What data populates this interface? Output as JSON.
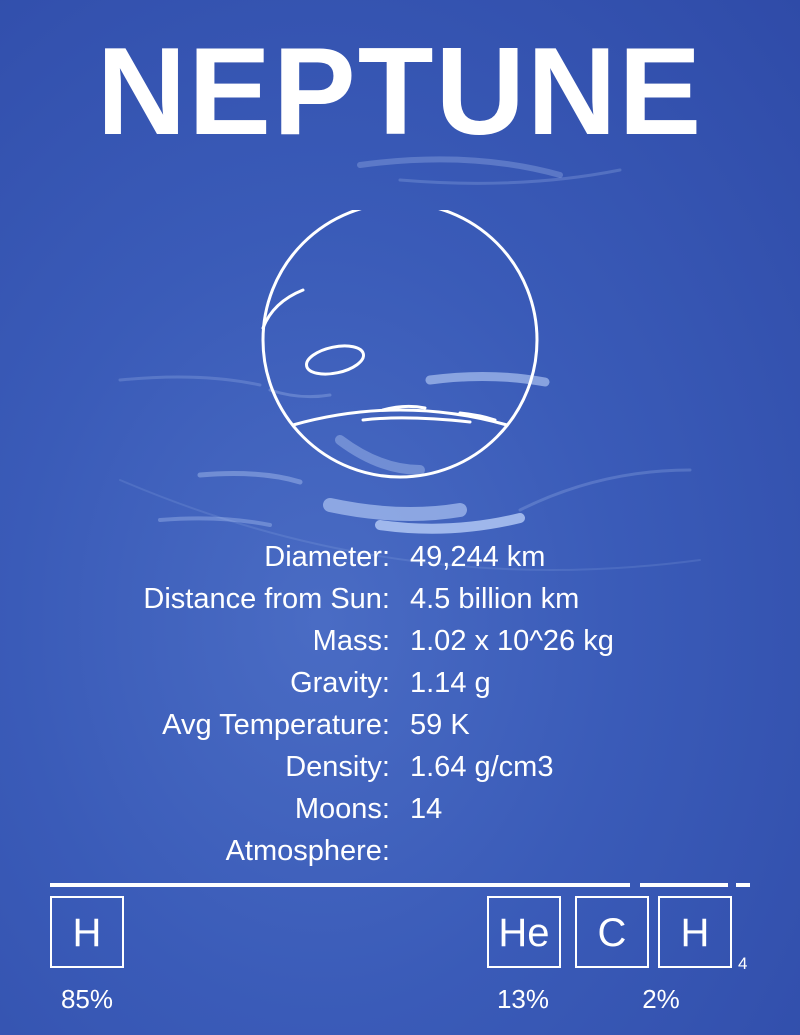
{
  "title": "NEPTUNE",
  "facts": [
    {
      "label": "Diameter:",
      "value": "49,244 km"
    },
    {
      "label": "Distance from Sun:",
      "value": "4.5 billion km"
    },
    {
      "label": "Mass:",
      "value": "1.02 x 10^26 kg"
    },
    {
      "label": "Gravity:",
      "value": "1.14 g"
    },
    {
      "label": "Avg Temperature:",
      "value": "59 K"
    },
    {
      "label": "Density:",
      "value": "1.64 g/cm3"
    },
    {
      "label": "Moons:",
      "value": "14"
    },
    {
      "label": "Atmosphere:",
      "value": ""
    }
  ],
  "atmosphere": {
    "elements": [
      {
        "symbol": "H"
      },
      {
        "symbol": "He"
      },
      {
        "symbol": "C"
      },
      {
        "symbol": "H",
        "subscript": "4"
      }
    ],
    "percentages": [
      "85%",
      "13%",
      "2%"
    ],
    "composition_fractions": [
      0.85,
      0.13,
      0.02
    ]
  },
  "colors": {
    "background": "#3a5bb8",
    "foreground": "#ffffff",
    "cloud": "#c8dcff"
  }
}
